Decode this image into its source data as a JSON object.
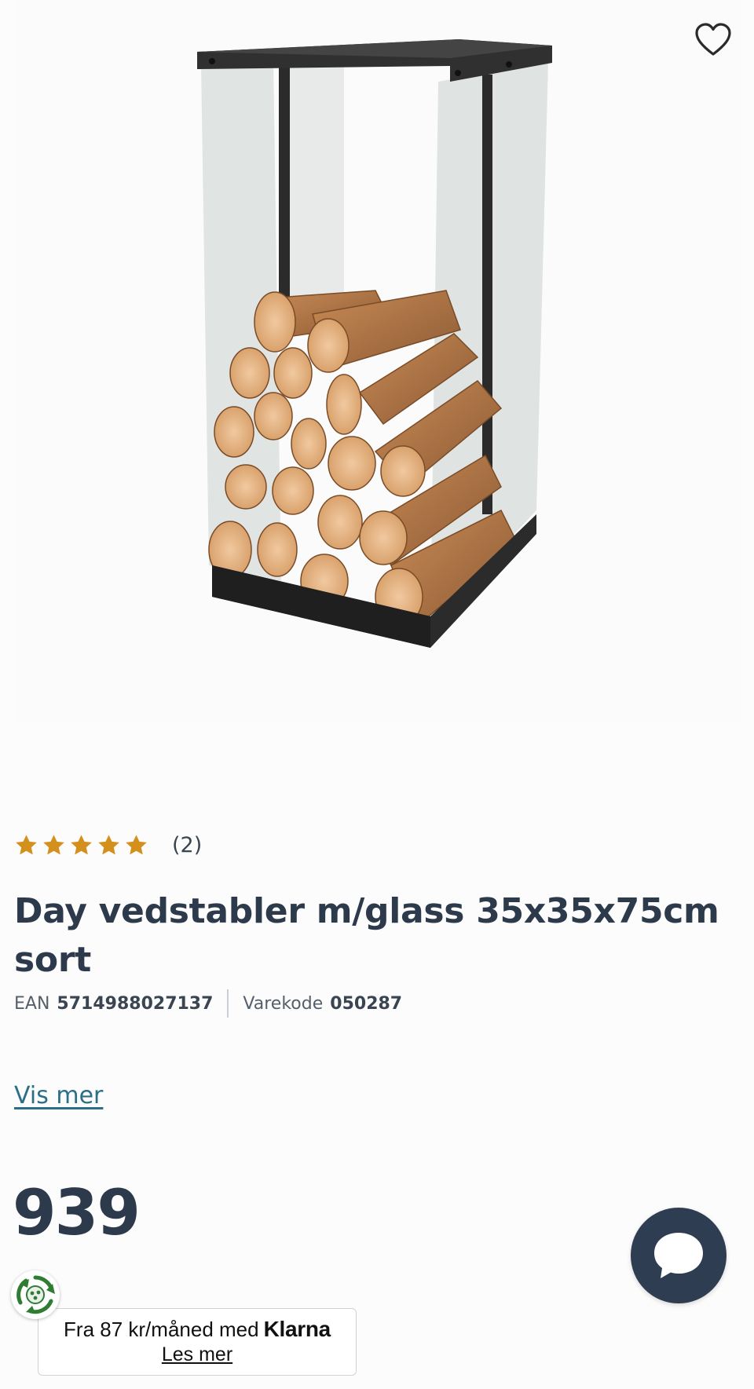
{
  "product": {
    "image_alt": "Day vedstabler m/glass 35x35x75cm sort",
    "title": "Day vedstabler m/glass 35x35x75cm sort",
    "rating": {
      "stars": 5,
      "max_stars": 5,
      "count_label": "(2)"
    },
    "ean": {
      "label": "EAN",
      "value": "5714988027137"
    },
    "item_code": {
      "label": "Varekode",
      "value": "050287"
    },
    "show_more_label": "Vis mer",
    "price": "939"
  },
  "klarna": {
    "text": "Fra 87 kr/måned med",
    "brand": "Klarna",
    "link_label": "Les mer"
  },
  "icons": {
    "favorite": "heart-outline-icon",
    "chat": "chat-bubble-icon",
    "eco": "recycle-badge-icon",
    "star": "star-icon"
  },
  "colors": {
    "star": "#d3901c",
    "text": "#2c3a4b",
    "link": "#2a6f86",
    "chat_button": "#2f3d52",
    "eco_green": "#2f7d32"
  }
}
